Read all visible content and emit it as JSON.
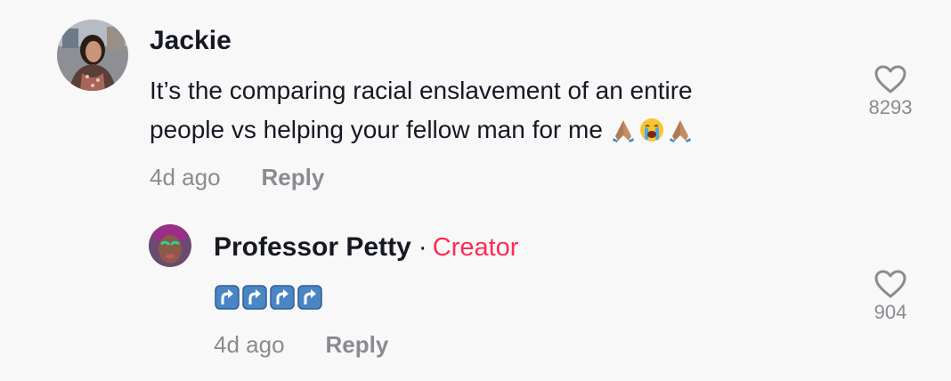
{
  "comments": [
    {
      "username": "Jackie",
      "text_line1": "It’s the comparing racial enslavement of an entire",
      "text_line2": "people vs helping your fellow man for me",
      "text_emojis": [
        "folded-hands",
        "loudly-crying-face",
        "folded-hands"
      ],
      "time": "4d ago",
      "reply_label": "Reply",
      "like_count": "8293",
      "like_icon": "heart-outline-icon"
    },
    {
      "username": "Professor Petty",
      "separator": "·",
      "badge": "Creator",
      "text_emojis": [
        "arrow-right-curving-up",
        "arrow-right-curving-up",
        "arrow-right-curving-up",
        "arrow-right-curving-up"
      ],
      "time": "4d ago",
      "reply_label": "Reply",
      "like_count": "904",
      "like_icon": "heart-outline-icon",
      "is_reply": true
    }
  ],
  "colors": {
    "background": "#f8f8f8",
    "text_primary": "#161823",
    "text_secondary": "#8a8b91",
    "creator_accent": "#fe2c55"
  }
}
